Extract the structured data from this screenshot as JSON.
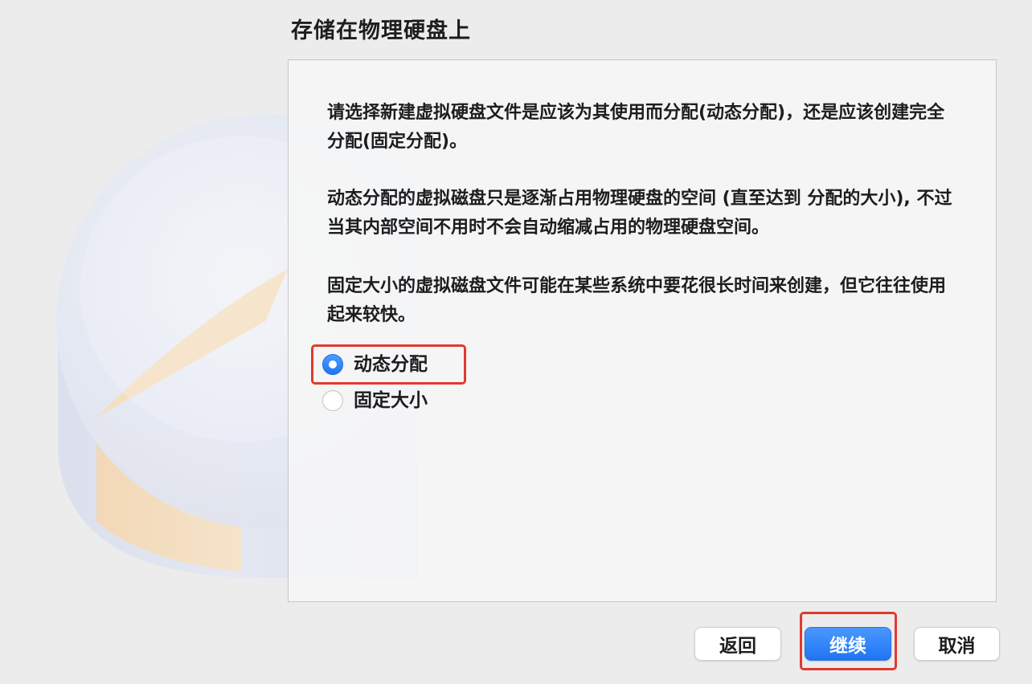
{
  "dialog": {
    "title": "存储在物理硬盘上"
  },
  "content": {
    "paragraph_1": "请选择新建虚拟硬盘文件是应该为其使用而分配(动态分配)，还是应该创建完全分配(固定分配)。",
    "paragraph_2": "动态分配的虚拟磁盘只是逐渐占用物理硬盘的空间 (直至达到 分配的大小), 不过当其内部空间不用时不会自动缩减占用的物理硬盘空间。",
    "paragraph_3": "固定大小的虚拟磁盘文件可能在某些系统中要花很长时间来创建，但它往往使用起来较快。"
  },
  "allocation_options": [
    {
      "label": "动态分配",
      "selected": true
    },
    {
      "label": "固定大小",
      "selected": false
    }
  ],
  "buttons": {
    "back": "返回",
    "continue": "继续",
    "cancel": "取消"
  },
  "colors": {
    "accent": "#1f74f2",
    "highlight": "#e03a2e",
    "background": "#ececec"
  },
  "icons": {
    "illustration": "hard-disk-pie-illustration"
  }
}
